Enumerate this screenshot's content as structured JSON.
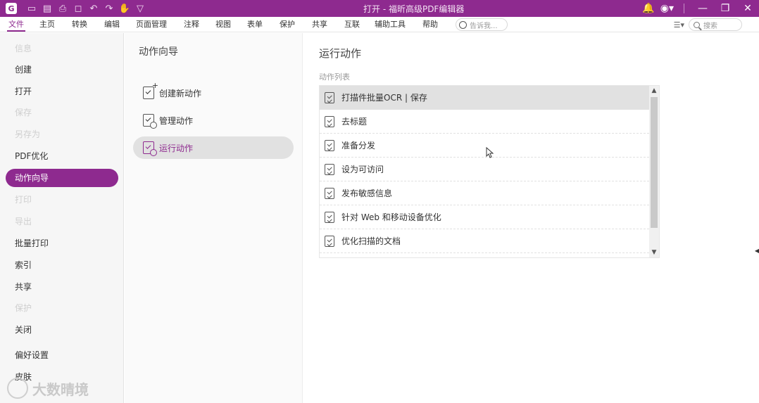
{
  "titlebar": {
    "app_logo": "G",
    "title": "打开 - 福昕高级PDF编辑器",
    "quick_access": [
      "folder-icon",
      "save-icon",
      "print-icon",
      "new-icon",
      "undo-icon",
      "redo-icon",
      "hand-icon",
      "dropdown-icon"
    ]
  },
  "menubar": {
    "tabs": [
      "文件",
      "主页",
      "转换",
      "编辑",
      "页面管理",
      "注释",
      "视图",
      "表单",
      "保护",
      "共享",
      "互联",
      "辅助工具",
      "帮助"
    ],
    "active_tab": "文件",
    "tellme_placeholder": "告诉我...",
    "search_placeholder": "搜索"
  },
  "sidebar": {
    "items": [
      {
        "label": "信息",
        "state": "dim"
      },
      {
        "label": "创建",
        "state": "normal"
      },
      {
        "label": "打开",
        "state": "normal"
      },
      {
        "label": "保存",
        "state": "dim"
      },
      {
        "label": "另存为",
        "state": "dim"
      },
      {
        "label": "PDF优化",
        "state": "normal"
      },
      {
        "label": "动作向导",
        "state": "active"
      },
      {
        "label": "打印",
        "state": "dim"
      },
      {
        "label": "导出",
        "state": "dim"
      },
      {
        "label": "批量打印",
        "state": "normal"
      },
      {
        "label": "索引",
        "state": "normal"
      },
      {
        "label": "共享",
        "state": "normal"
      },
      {
        "label": "保护",
        "state": "dim"
      },
      {
        "label": "关闭",
        "state": "normal"
      },
      {
        "label": "偏好设置",
        "state": "normal"
      },
      {
        "label": "皮肤",
        "state": "normal"
      }
    ],
    "watermark": "大数晴境"
  },
  "middle": {
    "title": "动作向导",
    "items": [
      {
        "label": "创建新动作",
        "icon": "create-action-icon",
        "active": false
      },
      {
        "label": "管理动作",
        "icon": "manage-action-icon",
        "active": false
      },
      {
        "label": "运行动作",
        "icon": "run-action-icon",
        "active": true
      }
    ]
  },
  "content": {
    "title": "运行动作",
    "list_label": "动作列表",
    "actions": [
      {
        "label": "打描件批量OCR | 保存",
        "selected": true
      },
      {
        "label": "去标题",
        "selected": false
      },
      {
        "label": "准备分发",
        "selected": false
      },
      {
        "label": "设为可访问",
        "selected": false
      },
      {
        "label": "发布敏感信息",
        "selected": false
      },
      {
        "label": "针对 Web 和移动设备优化",
        "selected": false
      },
      {
        "label": "优化扫描的文档",
        "selected": false
      }
    ]
  },
  "colors": {
    "brand": "#8e2a8f",
    "selected_row": "#e1e1e1"
  }
}
